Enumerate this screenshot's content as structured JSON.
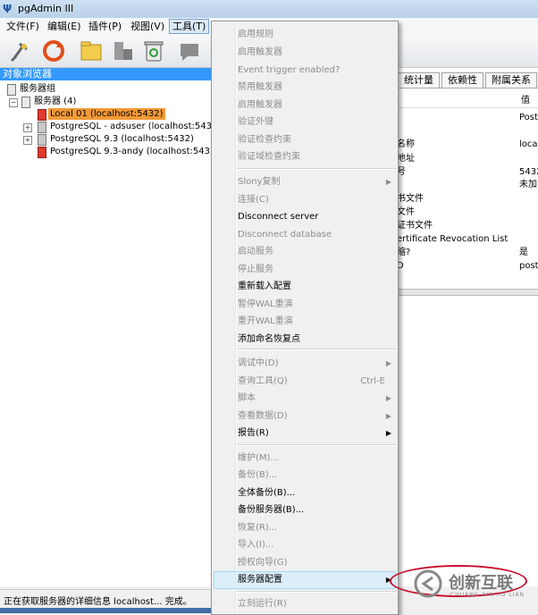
{
  "window": {
    "title": "pgAdmin III"
  },
  "menubar": [
    "文件(F)",
    "编辑(E)",
    "插件(P)",
    "视图(V)",
    "工具(T)",
    "帮助(H)"
  ],
  "toolbar": {
    "icons": [
      "connect-plug-icon",
      "refresh-icon",
      "folder-properties-icon",
      "server-icon",
      "recycle-icon",
      "sql-icon"
    ]
  },
  "object_browser": {
    "header": "对象浏览器",
    "root": "服务器组",
    "servers_label": "服务器 (4)",
    "servers": [
      {
        "label": "Local 01 (localhost:5432)",
        "selected": true
      },
      {
        "label": "PostgreSQL - adsuser (localhost:5432)"
      },
      {
        "label": "PostgreSQL 9.3 (localhost:5432)"
      },
      {
        "label": "PostgreSQL 9.3-andy (localhost:5432)"
      }
    ]
  },
  "right_tabs": [
    "统计量",
    "依赖性",
    "附属关系"
  ],
  "properties": {
    "value_header": "值",
    "rows": [
      {
        "label": "",
        "value": "Post"
      },
      {
        "label": "名称",
        "value": "local"
      },
      {
        "label": "地址",
        "value": ""
      },
      {
        "label": "号",
        "value": "5432"
      },
      {
        "label": "",
        "value": "未加"
      },
      {
        "label": "书文件",
        "value": ""
      },
      {
        "label": "文件",
        "value": ""
      },
      {
        "label": "证书文件",
        "value": ""
      },
      {
        "label": "ertificate Revocation List",
        "value": ""
      },
      {
        "label": "缩?",
        "value": "是"
      },
      {
        "label": "D",
        "value": "post"
      }
    ]
  },
  "context_menu": {
    "items": [
      {
        "label": "启用规则",
        "disabled": true
      },
      {
        "label": "启用触发器",
        "disabled": true
      },
      {
        "label": "Event trigger enabled?",
        "disabled": true
      },
      {
        "label": "禁用触发器",
        "disabled": true
      },
      {
        "label": "启用触发器",
        "disabled": true
      },
      {
        "label": "验证外键",
        "disabled": true
      },
      {
        "label": "验证检查约束",
        "disabled": true
      },
      {
        "label": "验证域检查约束",
        "disabled": true
      },
      {
        "label": "Slony复制",
        "disabled": true,
        "submenu": true
      },
      {
        "label": "连接(C)",
        "disabled": true
      },
      {
        "label": "Disconnect server",
        "disabled": false
      },
      {
        "label": "Disconnect database",
        "disabled": true
      },
      {
        "label": "启动服务",
        "disabled": true
      },
      {
        "label": "停止服务",
        "disabled": true
      },
      {
        "label": "重新载入配置",
        "disabled": false
      },
      {
        "label": "暂停WAL重演",
        "disabled": true
      },
      {
        "label": "重开WAL重演",
        "disabled": true
      },
      {
        "label": "添加命名恢复点",
        "disabled": false
      },
      {
        "label": "调试中(D)",
        "disabled": true,
        "submenu": true
      },
      {
        "label": "查询工具(Q)",
        "disabled": true,
        "shortcut": "Ctrl-E"
      },
      {
        "label": "脚本",
        "disabled": true,
        "submenu": true
      },
      {
        "label": "查看数据(D)",
        "disabled": true,
        "submenu": true
      },
      {
        "label": "报告(R)",
        "disabled": false,
        "submenu": true
      },
      {
        "label": "维护(M)...",
        "disabled": true
      },
      {
        "label": "备份(B)...",
        "disabled": true
      },
      {
        "label": "全体备份(B)...",
        "disabled": false
      },
      {
        "label": "备份服务器(B)...",
        "disabled": false
      },
      {
        "label": "恢复(R)...",
        "disabled": true
      },
      {
        "label": "导入(I)...",
        "disabled": true
      },
      {
        "label": "授权向导(G)",
        "disabled": true
      },
      {
        "label": "服务器配置",
        "disabled": false,
        "submenu": true,
        "highlighted": true
      },
      {
        "label": "立刻运行(R)",
        "disabled": true
      }
    ]
  },
  "status": {
    "text": "正在获取服务器的详细信息 localhost... 完成。"
  },
  "watermark": {
    "brand": "创新互联",
    "sub": "CHUANG XIN HU LIAN"
  }
}
